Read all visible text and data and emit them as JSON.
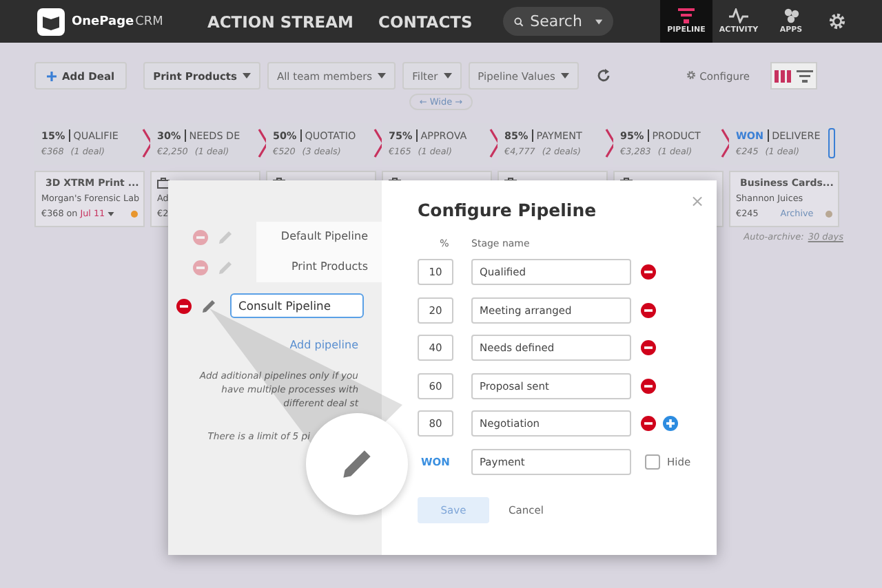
{
  "nav": {
    "logo_main": "OnePage",
    "logo_sub": "CRM",
    "links": [
      "ACTION STREAM",
      "CONTACTS"
    ],
    "search": {
      "placeholder": "Search"
    },
    "apps": [
      {
        "label": "PIPELINE",
        "kind": "pipeline",
        "selected": true
      },
      {
        "label": "ACTIVITY",
        "kind": "activity",
        "selected": false
      },
      {
        "label": "APPS",
        "kind": "apps",
        "selected": false
      }
    ]
  },
  "toolbar": {
    "add_deal": "Add Deal",
    "dropdowns": [
      {
        "label": "Print Products",
        "bold": true
      },
      {
        "label": "All team members",
        "bold": false
      },
      {
        "label": "Filter",
        "bold": false
      },
      {
        "label": "Pipeline Values",
        "bold": false
      }
    ],
    "configure": "Configure",
    "wide": "← Wide →"
  },
  "stages": [
    {
      "percent": "15%",
      "kind": "open",
      "name": "QUALIFIE",
      "value": "€368",
      "deals": "(1 deal)"
    },
    {
      "percent": "30%",
      "kind": "open",
      "name": "NEEDS DE",
      "value": "€2,250",
      "deals": "(1 deal)"
    },
    {
      "percent": "50%",
      "kind": "open",
      "name": "QUOTATIO",
      "value": "€520",
      "deals": "(3 deals)"
    },
    {
      "percent": "75%",
      "kind": "open",
      "name": "APPROVA",
      "value": "€165",
      "deals": "(1 deal)"
    },
    {
      "percent": "85%",
      "kind": "open",
      "name": "PAYMENT",
      "value": "€4,777",
      "deals": "(2 deals)"
    },
    {
      "percent": "95%",
      "kind": "open",
      "name": "PRODUCT",
      "value": "€3,283",
      "deals": "(1 deal)"
    },
    {
      "percent": "WON",
      "kind": "won",
      "name": "DELIVERE",
      "value": "€245",
      "deals": "(1 deal)"
    }
  ],
  "cards": [
    {
      "kind": "deal",
      "title": "3D XTRM Print ...",
      "company": "Morgan's Forensic Lab",
      "amount": "€368",
      "on": "on",
      "date": "Jul 11",
      "color": "#e8962e"
    },
    {
      "kind": "deal",
      "company": "Ad",
      "amount": "€2"
    },
    {
      "kind": "deal"
    },
    {
      "kind": "deal"
    },
    {
      "kind": "deal"
    },
    {
      "kind": "deal"
    },
    {
      "kind": "deal",
      "title": "Business Cards...",
      "company": "Shannon Juices",
      "amount": "€245",
      "archive": "Archive",
      "color": "#b8a894"
    }
  ],
  "auto_archive": {
    "label": "Auto-archive:",
    "link": "30 days"
  },
  "modal": {
    "title": "Configure Pipeline",
    "close": "×",
    "pipelines": [
      {
        "name": "Default Pipeline",
        "selected": false
      },
      {
        "name": "Print Products",
        "selected": false
      },
      {
        "name": "Consult Pipeline",
        "selected": true
      }
    ],
    "add_pipeline": "Add pipeline",
    "note": "Add aditional pipelines only if you have multiple processes with different deal st",
    "limit": "There is a limit of 5 pi",
    "headers": [
      "%",
      "Stage name"
    ],
    "stages": [
      {
        "kind": "stage",
        "percent": "10",
        "name": "Qualified",
        "can_add": false
      },
      {
        "kind": "stage",
        "percent": "20",
        "name": "Meeting arranged",
        "can_add": false
      },
      {
        "kind": "stage",
        "percent": "40",
        "name": "Needs defined",
        "can_add": false
      },
      {
        "kind": "stage",
        "percent": "60",
        "name": "Proposal sent",
        "can_add": false
      },
      {
        "kind": "stage",
        "percent": "80",
        "name": "Negotiation",
        "can_add": true
      },
      {
        "kind": "won",
        "percent": "WON",
        "name": "Payment"
      }
    ],
    "hide": {
      "label": "Hide",
      "checked": false
    },
    "save": {
      "label": "Save",
      "disabled": true
    },
    "cancel": "Cancel"
  }
}
